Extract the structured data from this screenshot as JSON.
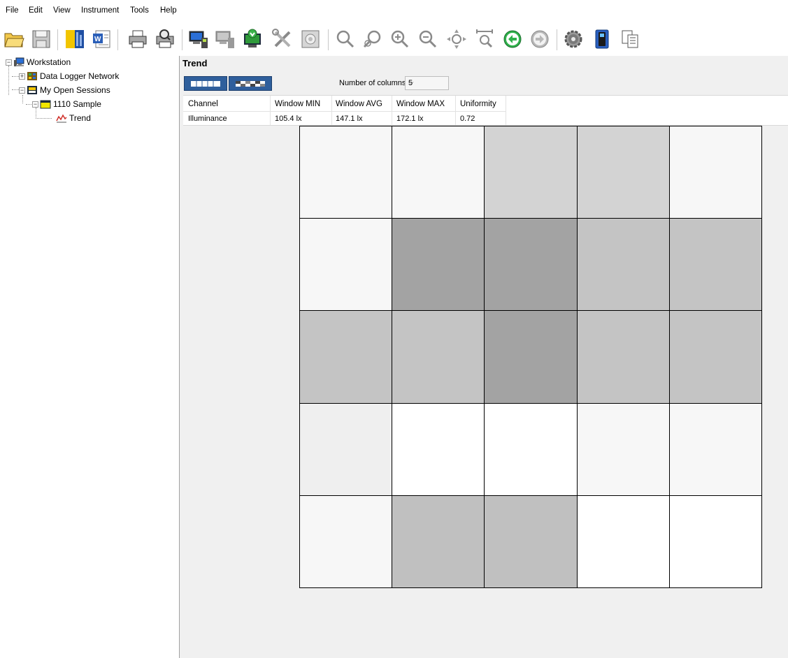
{
  "menu": [
    "File",
    "Edit",
    "View",
    "Instrument",
    "Tools",
    "Help"
  ],
  "toolbar": {
    "icons": [
      "open-icon",
      "save-icon",
      "dataview-icon",
      "word-report-icon",
      "print-icon",
      "print-preview-icon",
      "connect-instrument-icon",
      "disconnect-instrument-icon",
      "download-icon",
      "settings-tools-icon",
      "screenshot-icon",
      "zoom-icon",
      "zoom-out-icon",
      "zoom-in-icon",
      "zoom-reset-icon",
      "pan-icon",
      "zoom-fit-icon",
      "back-icon",
      "forward-icon",
      "gear-icon",
      "instrument-icon",
      "copy-icon"
    ]
  },
  "tree": {
    "workstation": "Workstation",
    "network": "Data Logger Network",
    "sessions": "My Open Sessions",
    "sample": "1110 Sample",
    "trend": "Trend"
  },
  "trend": {
    "title": "Trend",
    "ncols_label": "Number of columns",
    "ncols_value": "5"
  },
  "stats": {
    "headers": [
      "Channel",
      "Window MIN",
      "Window AVG",
      "Window MAX",
      "Uniformity"
    ],
    "row": [
      "Illuminance",
      "105.4 lx",
      "147.1 lx",
      "172.1 lx",
      "0.72"
    ]
  },
  "grid": {
    "columns": 5,
    "cells": [
      "#f7f7f7",
      "#f7f7f7",
      "#d3d3d3",
      "#d3d3d3",
      "#f7f7f7",
      "#f7f7f7",
      "#a3a3a3",
      "#a3a3a3",
      "#c4c4c4",
      "#c4c4c4",
      "#c4c4c4",
      "#c4c4c4",
      "#a3a3a3",
      "#c4c4c4",
      "#c4c4c4",
      "#efefef",
      "#ffffff",
      "#ffffff",
      "#f7f7f7",
      "#f7f7f7",
      "#f7f7f7",
      "#c0c0c0",
      "#c0c0c0",
      "#ffffff",
      "#ffffff"
    ]
  }
}
